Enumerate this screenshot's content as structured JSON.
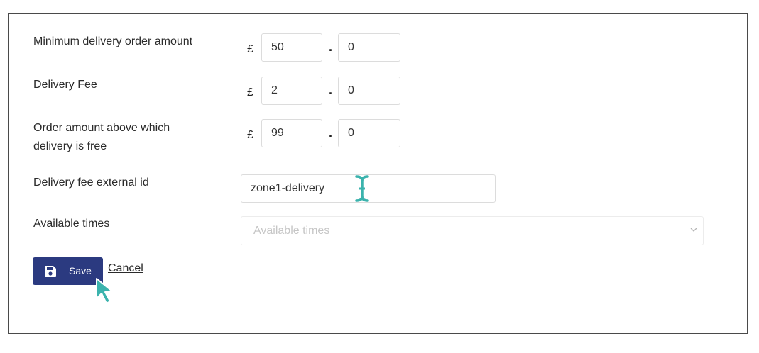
{
  "form": {
    "currency_symbol": "£",
    "decimal_separator": ".",
    "min_order": {
      "label": "Minimum delivery order amount",
      "int_value": "50",
      "frac_value": "0"
    },
    "delivery_fee": {
      "label": "Delivery Fee",
      "int_value": "2",
      "frac_value": "0"
    },
    "free_threshold": {
      "label_line1": "Order amount above which",
      "label_line2": "delivery is free",
      "int_value": "99",
      "frac_value": "0"
    },
    "external_id": {
      "label": "Delivery fee external id",
      "value": "zone1-delivery"
    },
    "available_times": {
      "label": "Available times",
      "placeholder": "Available times"
    }
  },
  "actions": {
    "save_label": "Save",
    "cancel_label": "Cancel"
  },
  "colors": {
    "primary_button": "#2b3a80",
    "cursor_accent": "#3bb3ad",
    "panel_border": "#4a4a4a"
  },
  "icons": {
    "save": "floppy-disk-icon",
    "select_arrow": "chevron-down-icon",
    "text_cursor": "i-beam-cursor-icon",
    "mouse_cursor": "arrow-pointer-icon"
  }
}
